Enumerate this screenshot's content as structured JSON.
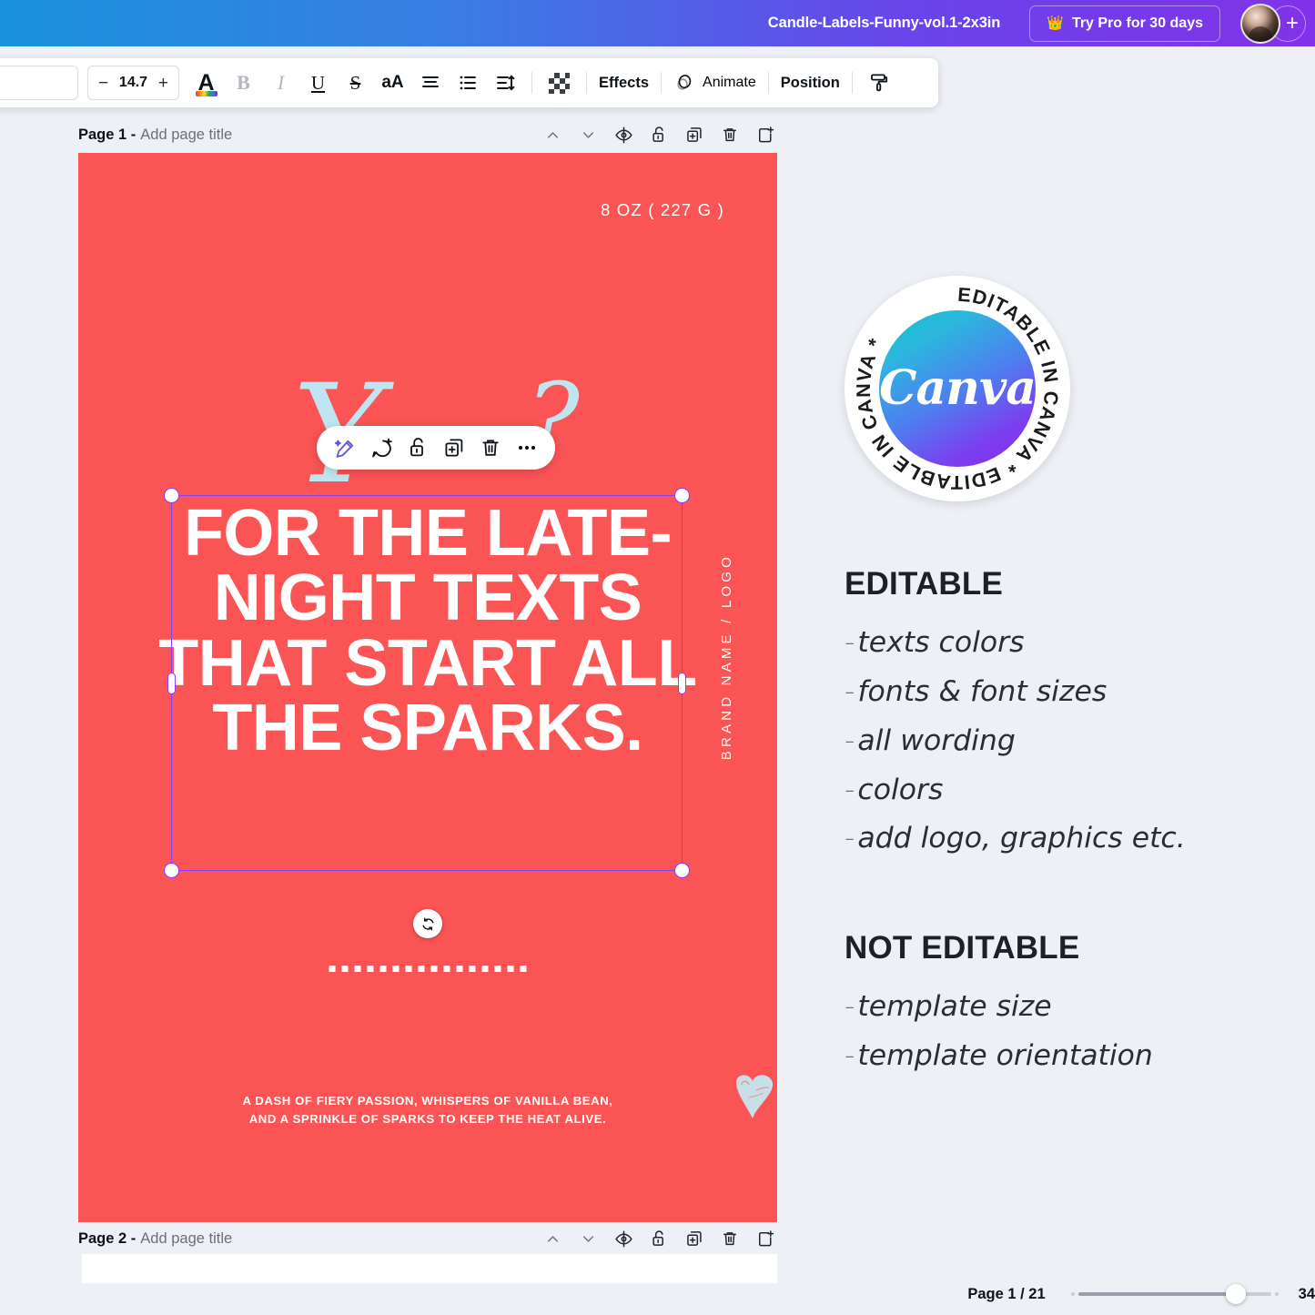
{
  "header": {
    "doc_title": "Candle-Labels-Funny-vol.1-2x3in",
    "try_pro_label": "Try Pro for 30 days",
    "crown_icon": "crown-icon",
    "avatar": "user-avatar",
    "add_icon": "plus-icon",
    "gradient_from": "#1a93dd",
    "gradient_to": "#8132e8"
  },
  "toolbar": {
    "font_name": "",
    "font_name_placeholder": "",
    "decrease_label": "−",
    "font_size": "14.7",
    "increase_label": "+",
    "text_color_label": "A",
    "bold_label": "B",
    "italic_label": "I",
    "underline_label": "U",
    "strike_label": "S",
    "case_label": "aA",
    "effects_label": "Effects",
    "animate_label": "Animate",
    "position_label": "Position"
  },
  "pages": [
    {
      "num_label": "Page 1 -",
      "title_placeholder": "Add page title"
    },
    {
      "num_label": "Page 2 -",
      "title_placeholder": "Add page title"
    }
  ],
  "context_pill": {
    "items": [
      "magic-edit-icon",
      "comment-add-icon",
      "lock-icon",
      "duplicate-icon",
      "delete-icon",
      "more-options-icon"
    ]
  },
  "design": {
    "background_color": "#FB5454",
    "weight_text": "8 OZ ( 227 G )",
    "brand_vertical": "BRAND NAME / LOGO",
    "script_left": "Y",
    "script_right": "?",
    "headline": "FOR THE LATE-NIGHT TEXTS THAT START ALL THE SPARKS.",
    "bottom_line_1": "A DASH OF FIERY PASSION, WHISPERS OF VANILLA BEAN,",
    "bottom_line_2": "AND A SPRINKLE OF SPARKS TO KEEP THE HEAT ALIVE.",
    "accent_color": "#BFE6F0",
    "selection_color": "#8B3DFF"
  },
  "badge": {
    "ring_text": "EDITABLE IN CANVA * EDITABLE IN CANVA * ",
    "center_word": "Canva",
    "gradient_from": "#16c0c8",
    "gradient_to": "#8a2be2"
  },
  "panel": {
    "editable_heading": "EDITABLE",
    "editable_items": [
      "texts colors",
      "fonts & font sizes",
      "all wording",
      "colors",
      "add logo, graphics etc."
    ],
    "not_editable_heading": "NOT EDITABLE",
    "not_editable_items": [
      "template size",
      "template orientation"
    ],
    "dash": "-"
  },
  "statusbar": {
    "page_indicator": "Page 1 / 21",
    "zoom_value": "34"
  }
}
